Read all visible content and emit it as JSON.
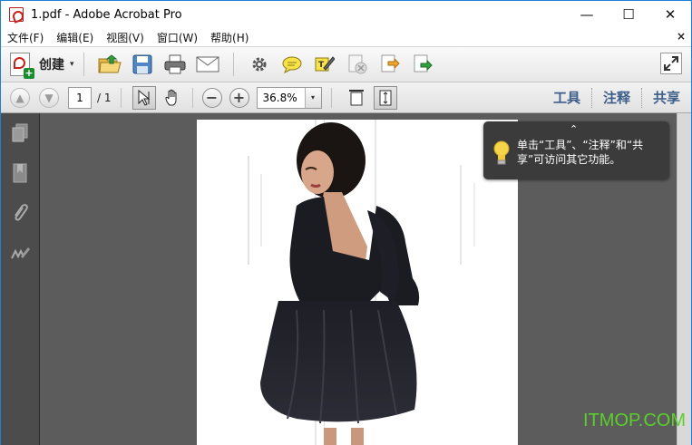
{
  "window": {
    "title": "1.pdf - Adobe Acrobat Pro",
    "controls": {
      "minimize": "—",
      "maximize": "☐",
      "close": "✕"
    }
  },
  "menubar": {
    "items": [
      {
        "label": "文件(F)"
      },
      {
        "label": "编辑(E)"
      },
      {
        "label": "视图(V)"
      },
      {
        "label": "窗口(W)"
      },
      {
        "label": "帮助(H)"
      }
    ],
    "doc_close": "×"
  },
  "toolbar": {
    "create_label": "创建",
    "caret": "▾",
    "icons": [
      "open-folder-icon",
      "save-icon",
      "print-icon",
      "email-icon",
      "settings-gear-icon",
      "comment-icon",
      "sign-pen-icon",
      "delete-doc-icon",
      "export-icon",
      "share-icon"
    ]
  },
  "navbar": {
    "page_current": "1",
    "page_total": "/ 1",
    "zoom_value": "36.8%",
    "zoom_caret": "▾",
    "zoom_out": "−",
    "zoom_in": "+",
    "tabs": [
      {
        "label": "工具"
      },
      {
        "label": "注释"
      },
      {
        "label": "共享"
      }
    ]
  },
  "tooltip": {
    "caret": "⌃",
    "text": "单击“工具”、“注释”和“共享”可访问其它功能。"
  },
  "watermark": "ITMOP.COM",
  "colors": {
    "tab_link": "#3c5e89",
    "nav_panel": "#4c4c4c",
    "doc_background": "#5c5c5c",
    "tooltip_bg": "#3b3b3b",
    "watermark": "#5ad02c"
  }
}
